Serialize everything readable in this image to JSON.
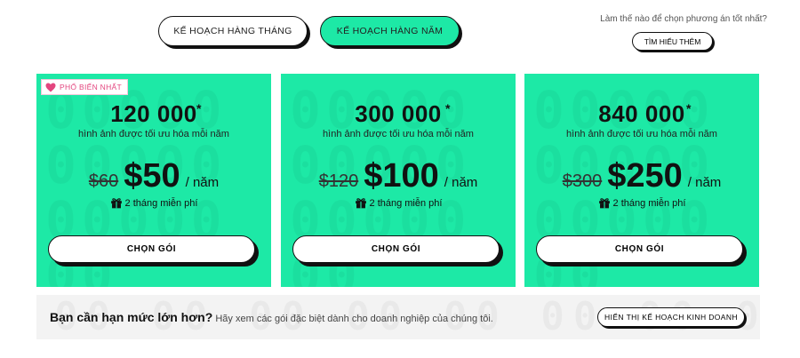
{
  "toggle": {
    "monthly_label": "KẾ HOẠCH HÀNG THÁNG",
    "yearly_label": "KẾ HOẠCH HÀNG NĂM"
  },
  "help": {
    "question": "Làm thế nào để chọn phương án tốt nhất?",
    "learn_more_label": "TÌM HIỂU THÊM"
  },
  "plans": [
    {
      "badge": "PHỔ BIẾN NHẤT",
      "count": "120 000",
      "star": "*",
      "description": "hình ảnh được tối ưu hóa mỗi năm",
      "old_price": "$60",
      "price": "$50",
      "per": "/ năm",
      "free": "2 tháng miễn phí",
      "cta": "CHỌN GÓI"
    },
    {
      "count": "300 000",
      "star": "*",
      "description": "hình ảnh được tối ưu hóa mỗi năm",
      "old_price": "$120",
      "price": "$100",
      "per": "/ năm",
      "free": "2 tháng miễn phí",
      "cta": "CHỌN GÓI"
    },
    {
      "count": "840 000",
      "star": "*",
      "description": "hình ảnh được tối ưu hóa mỗi năm",
      "old_price": "$300",
      "price": "$250",
      "per": "/ năm",
      "free": "2 tháng miễn phí",
      "cta": "CHỌN GÓI"
    }
  ],
  "enterprise": {
    "heading": "Bạn cần hạn mức lớn hơn?",
    "text": "Hãy xem các gói đặc biệt dành cho doanh nghiệp của chúng tôi.",
    "button_label": "HIỂN THỊ KẾ HOẠCH KINH DOANH"
  },
  "colors": {
    "accent": "#1de9a6",
    "badge_text": "#e3467f",
    "banner_bg": "#f3f3f3"
  },
  "icons": [
    "heart-icon",
    "gift-icon"
  ]
}
